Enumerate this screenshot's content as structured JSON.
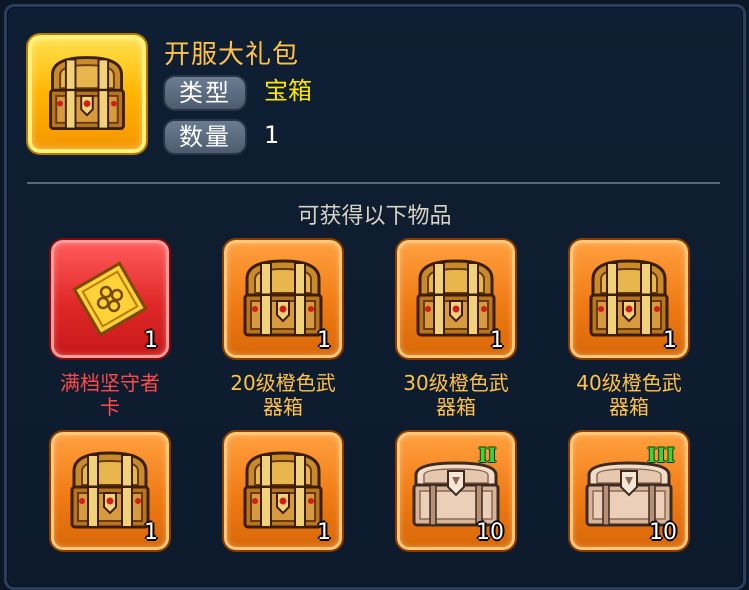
{
  "header": {
    "title": "开服大礼包",
    "type_label": "类型",
    "type_value": "宝箱",
    "quantity_label": "数量",
    "quantity_value": "1"
  },
  "section_title": "可获得以下物品",
  "colors": {
    "title": "#ffc247",
    "type_value": "#ffe600",
    "red_item_name": "#ff4a4a",
    "orange_item_name": "#ffc247"
  },
  "items": [
    {
      "name": "满档坚守者卡",
      "name_line1": "满档坚守者",
      "name_line2": "卡",
      "count": "1",
      "icon": "yellow-card-icon",
      "rarity": "red"
    },
    {
      "name": "20级橙色武器箱",
      "name_line1": "20级橙色武",
      "name_line2": "器箱",
      "count": "1",
      "icon": "gold-chest-icon",
      "rarity": "orange"
    },
    {
      "name": "30级橙色武器箱",
      "name_line1": "30级橙色武",
      "name_line2": "器箱",
      "count": "1",
      "icon": "gold-chest-icon",
      "rarity": "orange"
    },
    {
      "name": "40级橙色武器箱",
      "name_line1": "40级橙色武",
      "name_line2": "器箱",
      "count": "1",
      "icon": "gold-chest-icon",
      "rarity": "orange"
    },
    {
      "count": "1",
      "icon": "gold-chest-icon",
      "rarity": "orange"
    },
    {
      "count": "1",
      "icon": "gold-chest-icon",
      "rarity": "orange"
    },
    {
      "count": "10",
      "icon": "silver-chest-icon",
      "tier": "II",
      "rarity": "orange"
    },
    {
      "count": "10",
      "icon": "silver-chest-icon",
      "tier": "III",
      "rarity": "orange"
    }
  ]
}
